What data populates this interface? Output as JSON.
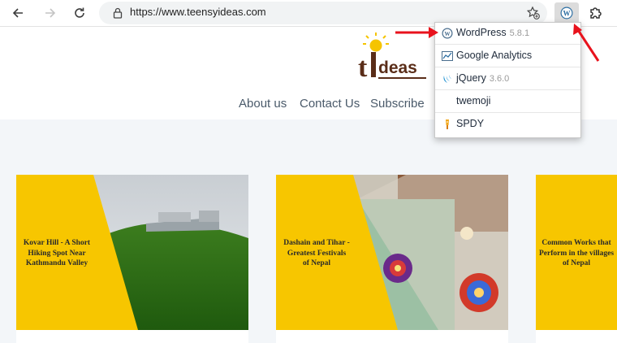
{
  "browser": {
    "url": "https://www.teensyideas.com",
    "icons": [
      "back-arrow-icon",
      "forward-arrow-icon",
      "reload-icon",
      "lock-icon",
      "add-favorite-icon",
      "wordpress-icon",
      "puzzle-icon"
    ]
  },
  "site": {
    "logo_text": "tIdeas",
    "nav": [
      "About us",
      "Contact Us",
      "Subscribe"
    ]
  },
  "posts": [
    {
      "title_lines": [
        "Kovar Hill - A Short",
        "Hiking Spot Near",
        "Kathmandu Valley"
      ]
    },
    {
      "title_lines": [
        "Dashain and Tihar -",
        "Greatest Festivals",
        "of Nepal"
      ]
    },
    {
      "title_lines": [
        "Common Works that",
        "Perform in the villages",
        "of Nepal"
      ]
    }
  ],
  "popup": {
    "items": [
      {
        "name": "WordPress",
        "version": "5.8.1",
        "icon": "wordpress-icon"
      },
      {
        "name": "Google Analytics",
        "version": "",
        "icon": "analytics-icon"
      },
      {
        "name": "jQuery",
        "version": "3.6.0",
        "icon": "jquery-icon"
      },
      {
        "name": "twemoji",
        "version": "",
        "icon": ""
      },
      {
        "name": "SPDY",
        "version": "",
        "icon": "spdy-icon"
      }
    ]
  },
  "colors": {
    "card_yellow": "#f7c600",
    "annotation_red": "#e8121c",
    "page_bg": "#f3f6f9"
  }
}
